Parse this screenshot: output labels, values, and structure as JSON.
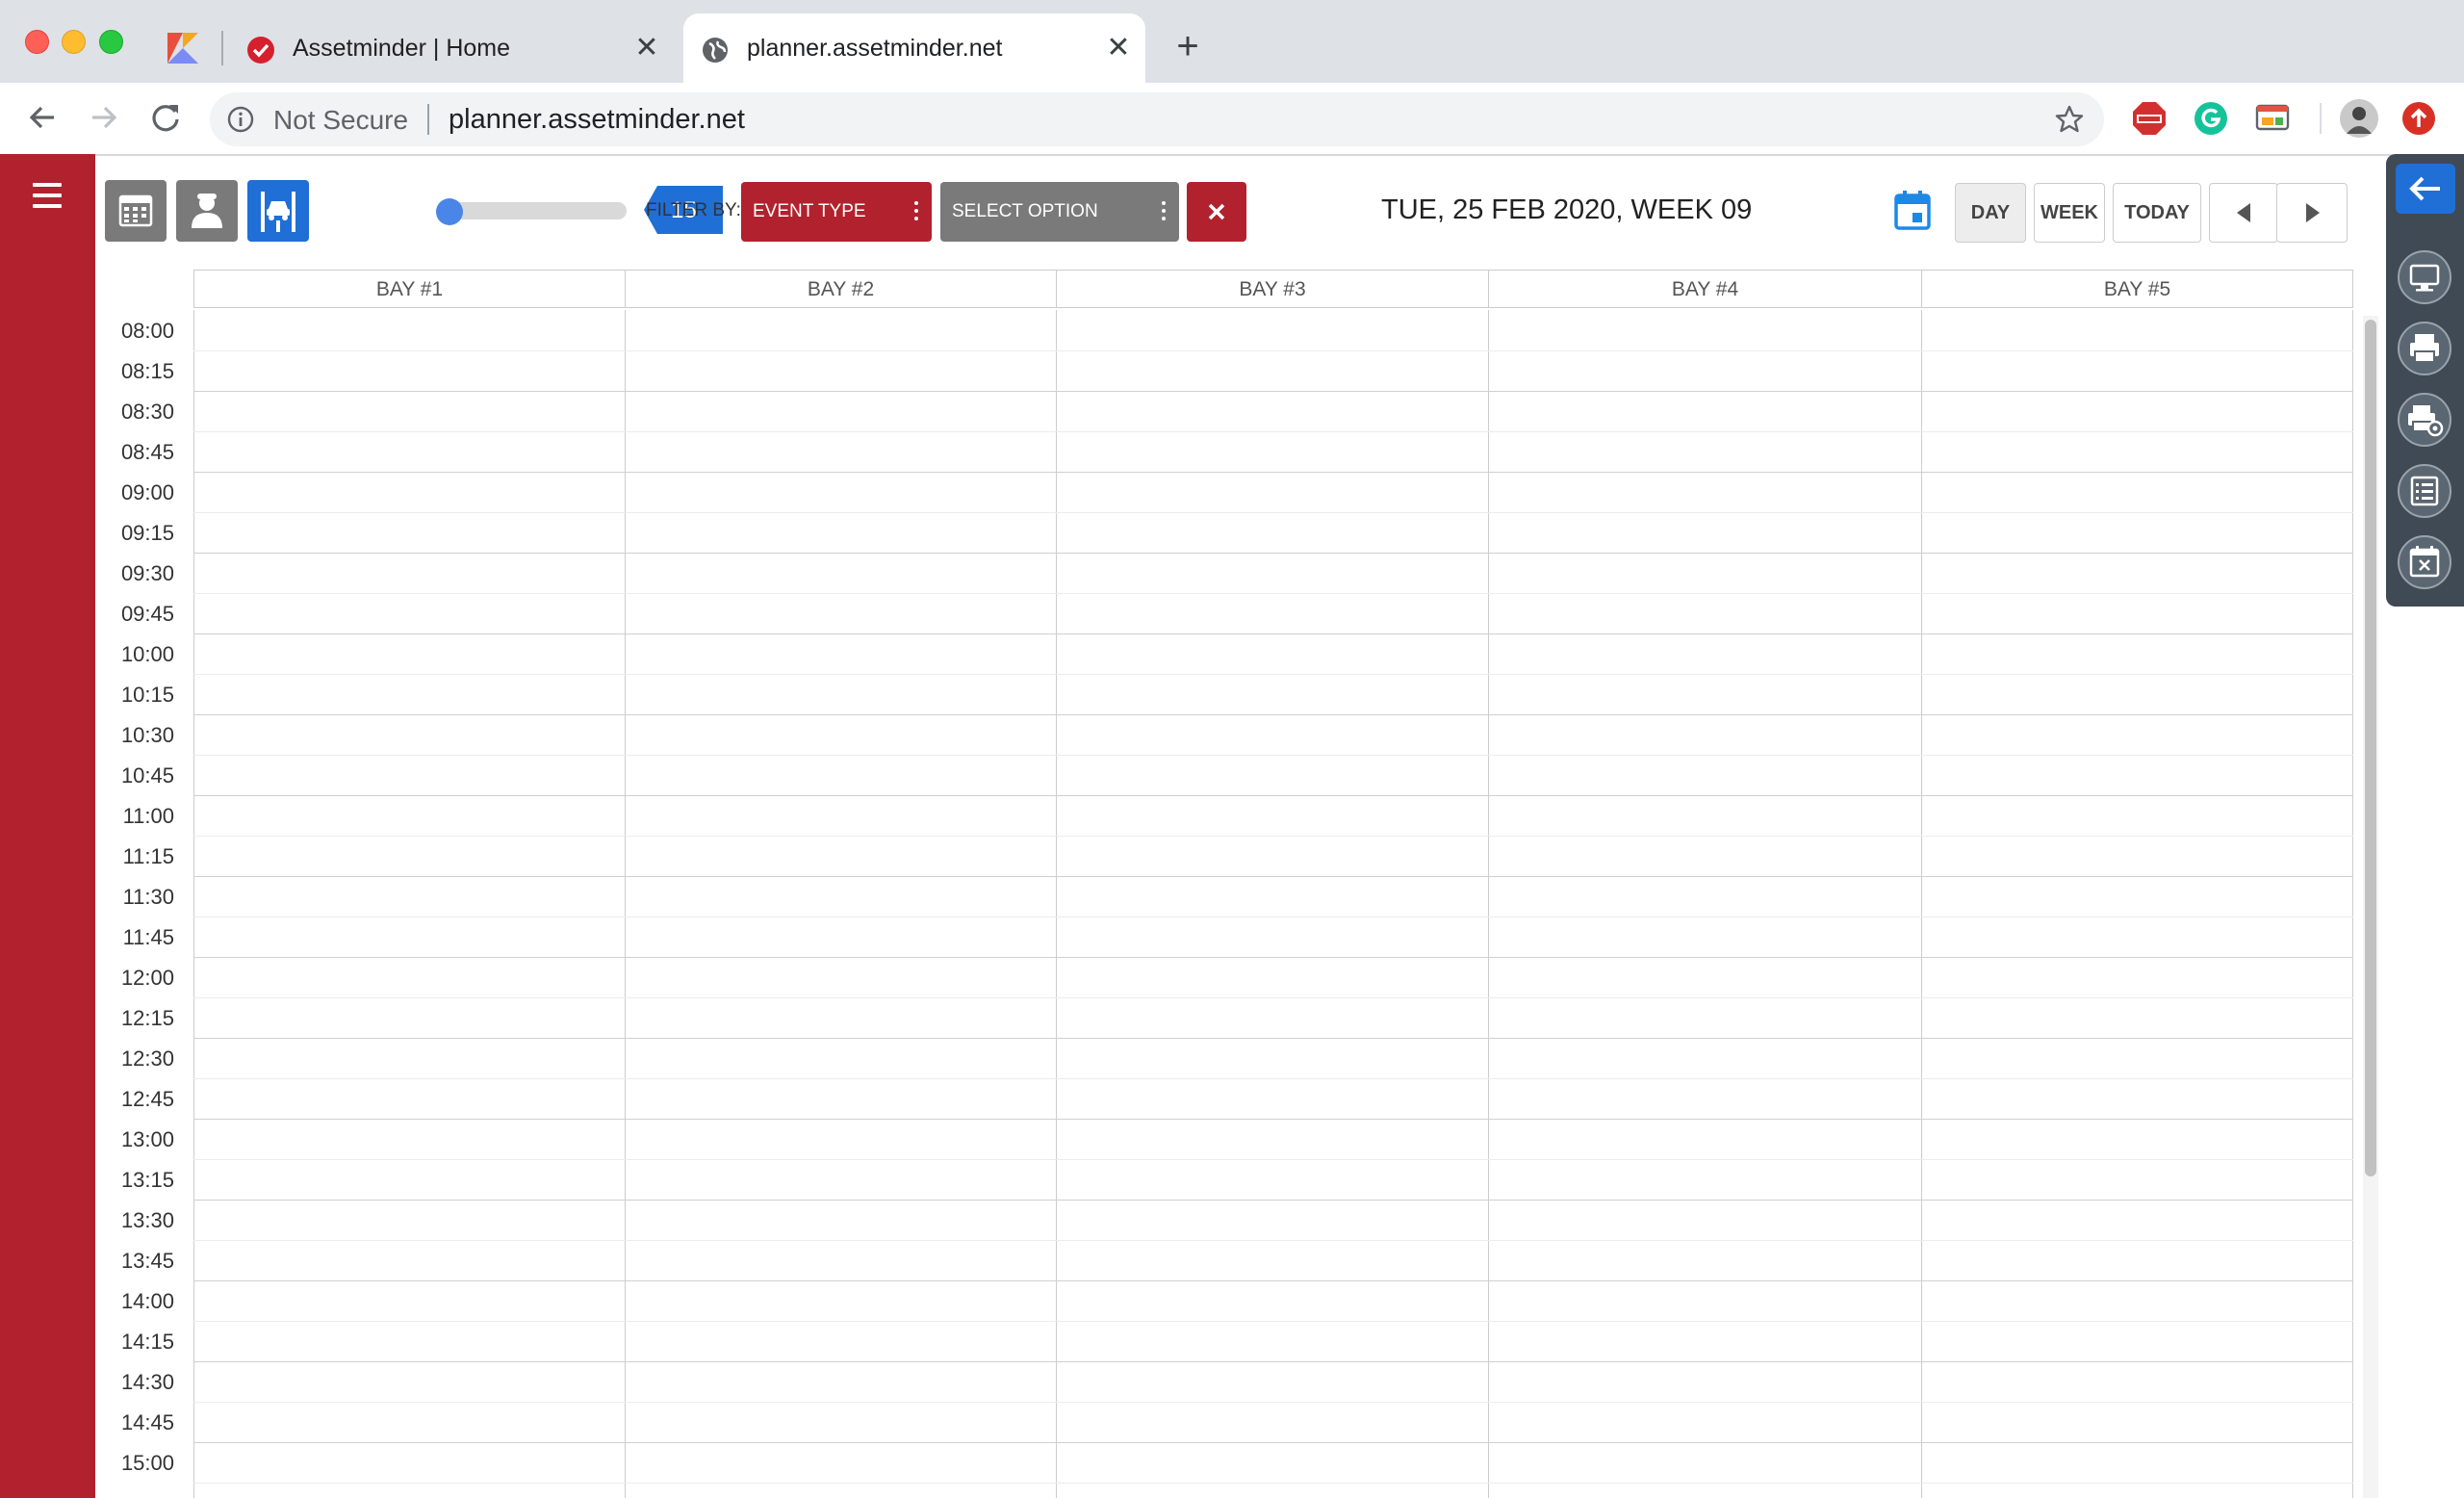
{
  "browser": {
    "tabs": [
      {
        "title": "Assetminder | Home",
        "active": false
      },
      {
        "title": "planner.assetminder.net",
        "active": true
      }
    ],
    "close_glyph": "✕",
    "newtab_glyph": "+",
    "security_text": "Not Secure",
    "url": "planner.assetminder.net"
  },
  "app": {
    "slider_value": "15",
    "filter_label": "FILTER BY:",
    "filter_event_type": "EVENT TYPE",
    "filter_select_option": "SELECT OPTION",
    "date_title": "TUE, 25 FEB 2020, WEEK 09",
    "view_day": "DAY",
    "view_week": "WEEK",
    "view_today": "TODAY"
  },
  "grid": {
    "bays": [
      "BAY #1",
      "BAY #2",
      "BAY #3",
      "BAY #4",
      "BAY #5"
    ],
    "times": [
      "08:00",
      "08:15",
      "08:30",
      "08:45",
      "09:00",
      "09:15",
      "09:30",
      "09:45",
      "10:00",
      "10:15",
      "10:30",
      "10:45",
      "11:00",
      "11:15",
      "11:30",
      "11:45",
      "12:00",
      "12:15",
      "12:30",
      "12:45",
      "13:00",
      "13:15",
      "13:30",
      "13:45",
      "14:00",
      "14:15",
      "14:30",
      "14:45",
      "15:00"
    ]
  },
  "colors": {
    "brand_red": "#b1222e",
    "accent_blue": "#1f6fd6",
    "select_gray": "#7a7a7a"
  }
}
